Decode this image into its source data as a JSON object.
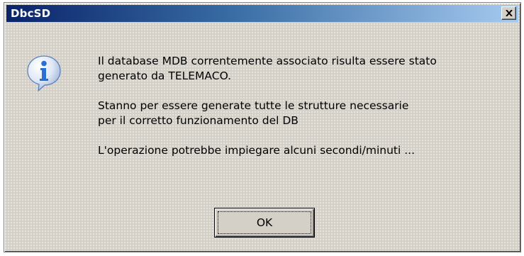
{
  "window": {
    "title": "DbcSD"
  },
  "titlebar": {
    "close_icon": "close-icon"
  },
  "dialog": {
    "icon": "info-icon",
    "paragraphs": {
      "p1_line1": "Il database MDB correntemente associato risulta essere stato",
      "p1_line2": "generato da TELEMACO.",
      "p2_line1": "Stanno per essere generate tutte le strutture necessarie",
      "p2_line2": "per il corretto funzionamento del DB",
      "p3_line1": "L'operazione potrebbe impiegare alcuni secondi/minuti ..."
    },
    "ok_label": "OK"
  },
  "colors": {
    "titlebar_start": "#0a246a",
    "titlebar_end": "#a6caf0",
    "dialog_bg": "#d4d0c8",
    "icon_blue": "#2a6fd6"
  }
}
